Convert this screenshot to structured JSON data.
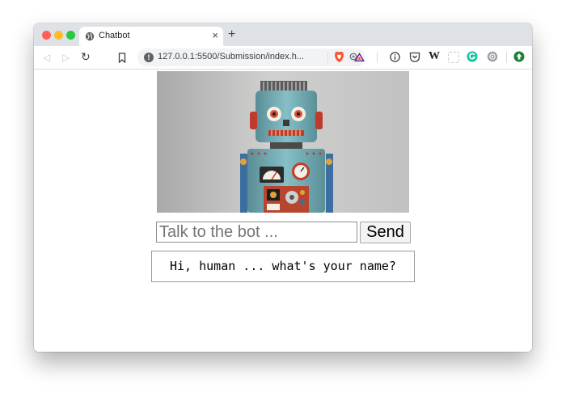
{
  "browser": {
    "tab_title": "Chatbot",
    "tab_close": "×",
    "new_tab": "+",
    "url": "127.0.0.1:5500/Submission/index.h...",
    "nav": {
      "back": "◁",
      "forward": "▷",
      "reload": "↻"
    },
    "extension_icons": [
      "brave-shields-icon",
      "brave-rewards-icon",
      "info-icon",
      "pocket-icon",
      "wikipedia-icon",
      "blank-extension-icon",
      "grammarly-icon",
      "extension-icon",
      "profile-icon"
    ],
    "wikipedia_label": "W"
  },
  "page": {
    "image_alt": "Toy robot",
    "input_placeholder": "Talk to the bot ...",
    "send_label": "Send",
    "bot_reply": "Hi, human ... what's your name?"
  }
}
